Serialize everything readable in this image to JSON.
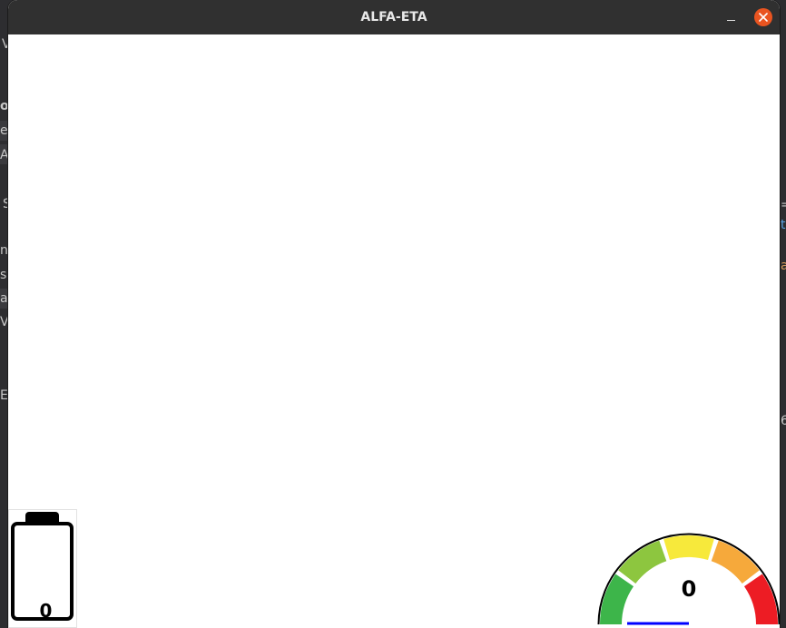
{
  "window": {
    "title": "ALFA-ETA",
    "controls": {
      "minimize_icon": "minimize-icon",
      "close_icon": "close-icon",
      "close_color": "#e95420"
    }
  },
  "background_fragments": [
    {
      "text": "V"
    },
    {
      "text": "o"
    },
    {
      "text": "ev"
    },
    {
      "text": "A"
    },
    {
      "text": "S"
    },
    {
      "text": "nt"
    },
    {
      "text": "s"
    },
    {
      "text": "a"
    },
    {
      "text": "V"
    },
    {
      "text": "E"
    },
    {
      "text": "="
    },
    {
      "text": "t"
    },
    {
      "text": "a"
    },
    {
      "text": "6"
    }
  ],
  "battery": {
    "value": "0",
    "level_percent": 0,
    "fill_color": "#4caf50"
  },
  "gauge": {
    "value": "0",
    "level": 0,
    "segment_colors": [
      "#3db54a",
      "#8dc63f",
      "#f7e93b",
      "#f6a93b",
      "#ed1c24"
    ],
    "needle_color": "#0000ff"
  }
}
